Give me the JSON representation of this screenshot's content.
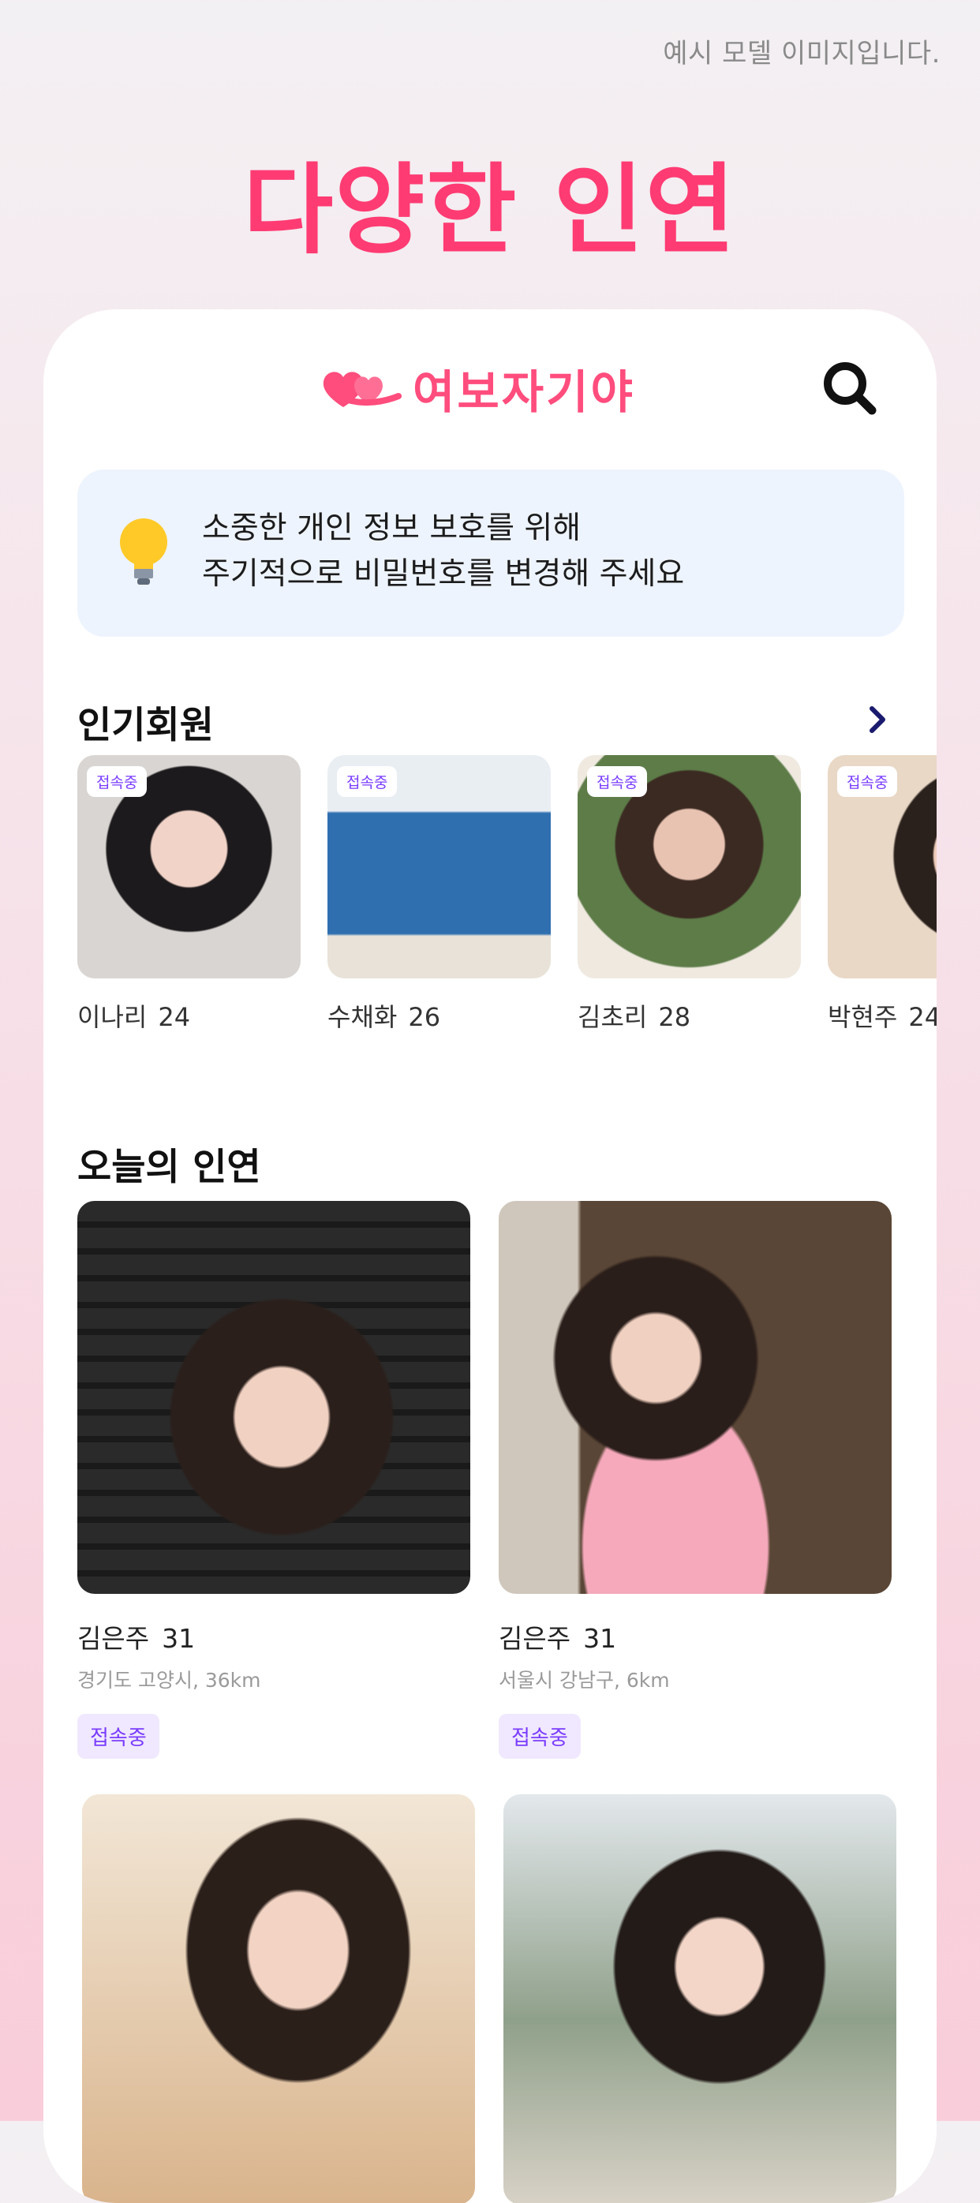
{
  "disclaimer": "예시 모델 이미지입니다.",
  "hero_title": "다양한 인연",
  "app": {
    "logo_text": "여보자기야"
  },
  "notice": {
    "line1": "소중한 개인 정보 보호를 위해",
    "line2": "주기적으로 비밀번호를 변경해 주세요"
  },
  "popular": {
    "title": "인기회원",
    "members": [
      {
        "status": "접속중",
        "name": "이나리",
        "age": "24"
      },
      {
        "status": "접속중",
        "name": "수채화",
        "age": "26"
      },
      {
        "status": "접속중",
        "name": "김초리",
        "age": "28"
      },
      {
        "status": "접속중",
        "name": "박현주",
        "age": "24"
      }
    ]
  },
  "today": {
    "title": "오늘의 인연",
    "cards": [
      {
        "name": "김은주",
        "age": "31",
        "location": "경기도 고양시, 36km",
        "status": "접속중"
      },
      {
        "name": "김은주",
        "age": "31",
        "location": "서울시 강남구, 6km",
        "status": "접속중"
      }
    ]
  },
  "colors": {
    "brand": "#ff3b73",
    "status": "#7a3cff",
    "notice_bg": "#eef4fd"
  }
}
